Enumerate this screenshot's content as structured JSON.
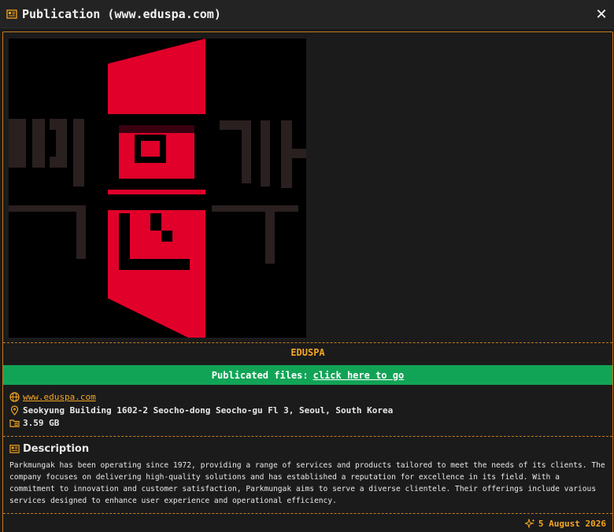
{
  "window": {
    "title": "Publication (www.eduspa.com)",
    "title_icon": "newspaper-icon",
    "close_label": "✕"
  },
  "company": {
    "name": "EDUSPA",
    "logo_icon": "eduspa-logo",
    "colors": {
      "accent": "#f5a623",
      "border": "#c47a1e",
      "files_bar": "#11a456",
      "logo_red": "#e0002a"
    }
  },
  "files": {
    "label": "Publicated files:",
    "link_text": "click here to go"
  },
  "details": {
    "website": "www.eduspa.com",
    "address": "Seokyung Building 1602-2 Seocho-dong Seocho-gu Fl 3, Seoul, South Korea",
    "size": "3.59 GB"
  },
  "description": {
    "heading": "Description",
    "text": "Parkmungak has been operating since 1972, providing a range of services and products tailored to meet the needs of its clients. The company focuses on delivering high-quality solutions and has established a reputation for excellence in its field. With a commitment to innovation and customer satisfaction, Parkmungak aims to serve a diverse clientele. Their offerings include various services designed to enhance user experience and operational efficiency."
  },
  "date": "5 August 2026"
}
